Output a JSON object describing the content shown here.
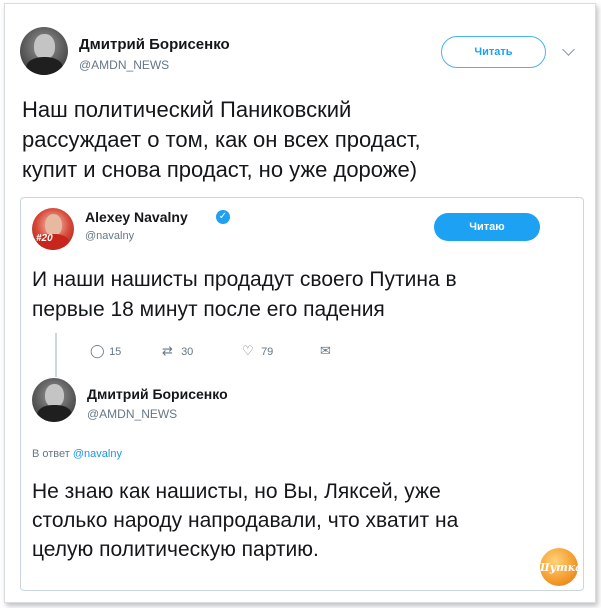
{
  "main_tweet": {
    "author_name": "Дмитрий Борисенко",
    "author_handle": "@AMDN_NEWS",
    "follow_label": "Читать",
    "text_lines": [
      "Наш политический Паниковский",
      "рассуждает о том, как он всех продаст,",
      "купит и снова продаст, но уже дороже)"
    ]
  },
  "quoted_tweet": {
    "author_name": "Alexey Navalny",
    "author_handle": "@navalny",
    "follow_label": "Читаю",
    "avatar_badge": "#20",
    "text_lines": [
      "И наши нашисты продадут своего Путина в",
      "первые 18 минут после его падения"
    ],
    "actions": {
      "replies": "15",
      "retweets": "30",
      "likes": "79"
    }
  },
  "reply_tweet": {
    "author_name": "Дмитрий Борисенко",
    "author_handle": "@AMDN_NEWS",
    "reply_prefix": "В ответ",
    "reply_to_handle": "@navalny",
    "text_lines": [
      "Не знаю как нашисты, но Вы, Ляксей, уже",
      "столько народу напродавали, что хватит на",
      "целую политическую партию."
    ]
  },
  "watermark": {
    "text": "Шутка"
  },
  "colors": {
    "accent": "#1da1f2",
    "text": "#14171a",
    "secondary": "#657786",
    "border": "#ccd6dd"
  }
}
